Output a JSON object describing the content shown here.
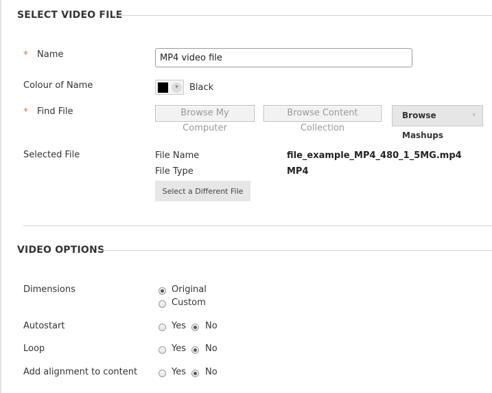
{
  "video_file_section": {
    "title": "SELECT VIDEO FILE",
    "name_label": "Name",
    "required_marker": "*",
    "name_value": "MP4 video file",
    "colour_label": "Colour of Name",
    "colour_value": "Black",
    "colour_hex": "#000000",
    "find_file_label": "Find File",
    "browse_computer": "Browse My Computer",
    "browse_content": "Browse Content Collection",
    "browse_mashups": "Browse Mashups",
    "selected_file_label": "Selected File",
    "file_name_label": "File Name",
    "file_name_value": "file_example_MP4_480_1_5MG.mp4",
    "file_type_label": "File Type",
    "file_type_value": "MP4",
    "select_different": "Select a Different File"
  },
  "video_options_section": {
    "title": "VIDEO OPTIONS",
    "dimensions_label": "Dimensions",
    "dimensions_options": [
      "Original",
      "Custom"
    ],
    "dimensions_selected": "Original",
    "autostart_label": "Autostart",
    "loop_label": "Loop",
    "alignment_label": "Add alignment to content",
    "yes": "Yes",
    "no": "No",
    "autostart_selected": "No",
    "loop_selected": "No",
    "alignment_selected": "No"
  }
}
